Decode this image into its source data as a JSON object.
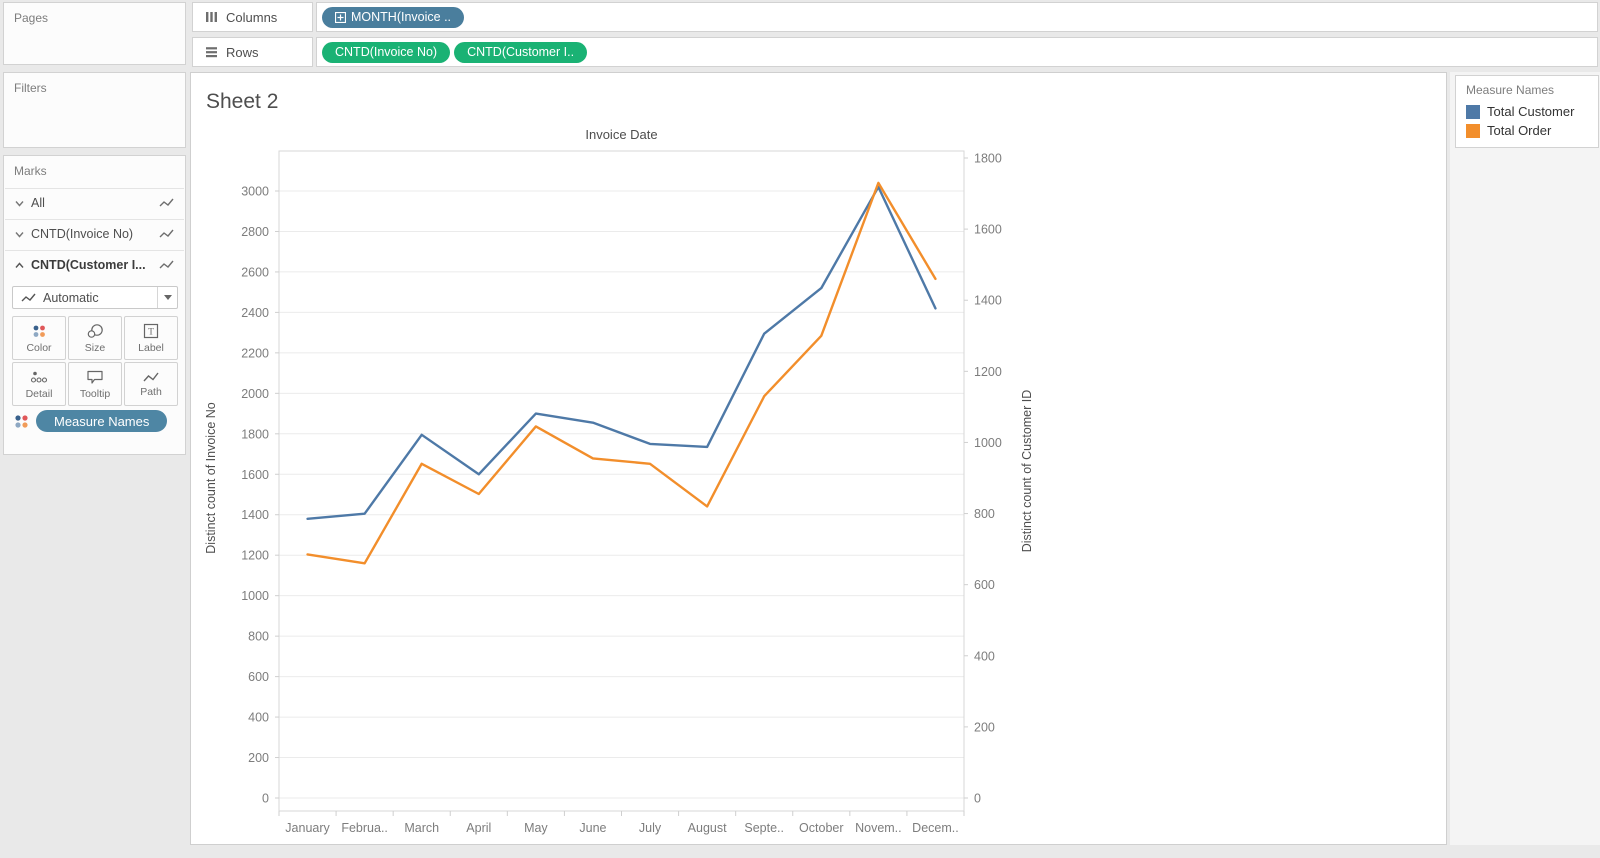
{
  "shelves": {
    "columns": {
      "label": "Columns",
      "pills": [
        {
          "text": "MONTH(Invoice ..",
          "color": "#4a7e9d"
        }
      ]
    },
    "rows": {
      "label": "Rows",
      "pills": [
        {
          "text": "CNTD(Invoice No)",
          "color": "#1ab274"
        },
        {
          "text": "CNTD(Customer I..",
          "color": "#1ab274"
        }
      ]
    }
  },
  "cards": {
    "pages": {
      "title": "Pages"
    },
    "filters": {
      "title": "Filters"
    },
    "marks": {
      "title": "Marks",
      "layers": [
        {
          "label": "All",
          "expanded": false
        },
        {
          "label": "CNTD(Invoice No)",
          "expanded": false
        },
        {
          "label": "CNTD(Customer I...",
          "expanded": true
        }
      ],
      "mark_type": "Automatic",
      "buttons": [
        "Color",
        "Size",
        "Label",
        "Detail",
        "Tooltip",
        "Path"
      ],
      "measure_pill": "Measure Names",
      "measure_pill_color": "#4e86a4"
    }
  },
  "sheet": {
    "title": "Sheet 2"
  },
  "legend": {
    "title": "Measure Names",
    "items": [
      {
        "label": "Total Customer",
        "color": "#4e79a7"
      },
      {
        "label": "Total Order",
        "color": "#f28e2b"
      }
    ]
  },
  "chart_data": {
    "type": "line",
    "title": "Invoice Date",
    "categories": [
      "January",
      "February",
      "March",
      "April",
      "May",
      "June",
      "July",
      "August",
      "September",
      "October",
      "November",
      "December"
    ],
    "categories_display": [
      "January",
      "Februa..",
      "March",
      "April",
      "May",
      "June",
      "July",
      "August",
      "Septe..",
      "October",
      "Novem..",
      "Decem.."
    ],
    "series": [
      {
        "name": "CNTD(Invoice No)",
        "legend_name": "Total Customer",
        "axis": "left",
        "color": "#4e79a7",
        "values": [
          1380,
          1405,
          1795,
          1600,
          1900,
          1855,
          1750,
          1735,
          2295,
          2520,
          3020,
          2420
        ]
      },
      {
        "name": "CNTD(Customer ID)",
        "legend_name": "Total Order",
        "axis": "right",
        "color": "#f28e2b",
        "values": [
          685,
          660,
          940,
          855,
          1045,
          955,
          940,
          820,
          1130,
          1300,
          1730,
          1460
        ]
      }
    ],
    "left_axis": {
      "title": "Distinct count of Invoice No",
      "range": [
        0,
        3000
      ],
      "ticks": [
        0,
        200,
        400,
        600,
        800,
        1000,
        1200,
        1400,
        1600,
        1800,
        2000,
        2200,
        2400,
        2600,
        2800,
        3000
      ]
    },
    "right_axis": {
      "title": "Distinct count of Customer ID",
      "range": [
        0,
        1800
      ],
      "ticks": [
        0,
        200,
        400,
        600,
        800,
        1000,
        1200,
        1400,
        1600,
        1800
      ]
    },
    "grid": true,
    "legend_position": "right"
  }
}
